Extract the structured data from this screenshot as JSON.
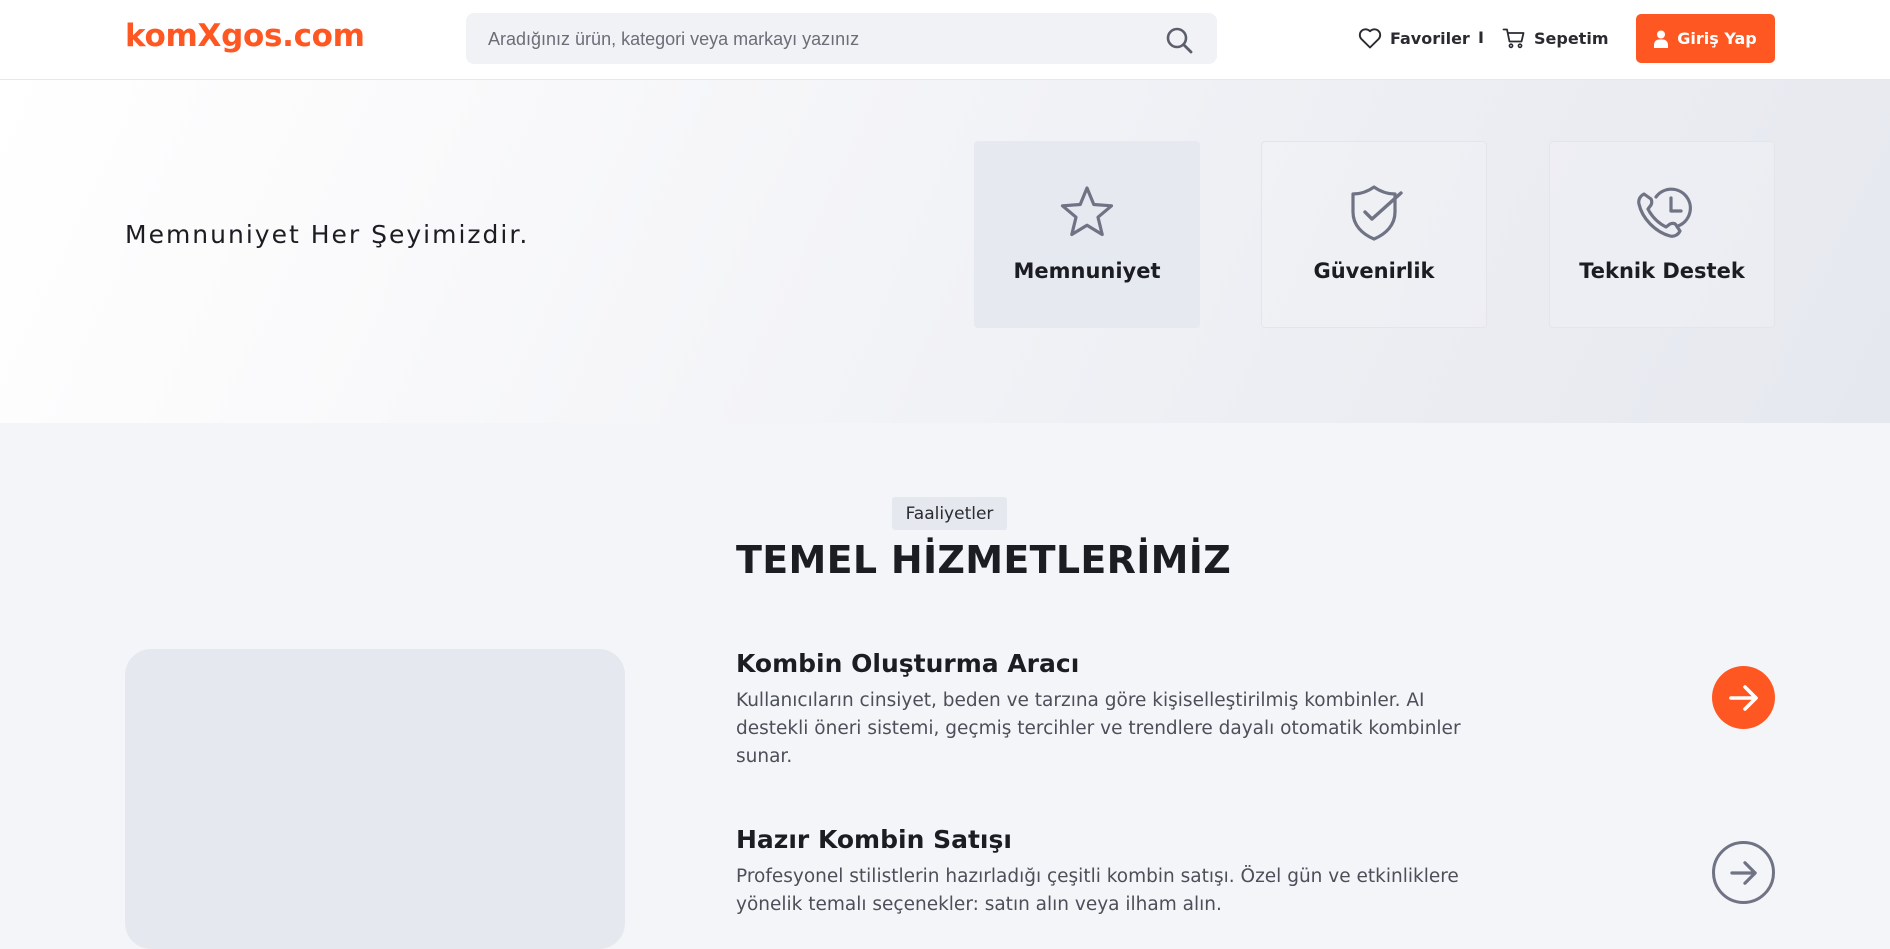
{
  "header": {
    "logo": "komXgos.com",
    "search_placeholder": "Aradığınız ürün, kategori veya markayı yazınız",
    "favorites_label": "Favoriler",
    "separator": "I",
    "cart_label": "Sepetim",
    "login_label": "Giriş Yap"
  },
  "hero": {
    "tagline": "Memnuniyet Her Şeyimizdir.",
    "features": [
      {
        "label": "Memnuniyet",
        "icon": "star-icon"
      },
      {
        "label": "Güvenirlik",
        "icon": "shield-check-icon"
      },
      {
        "label": "Teknik Destek",
        "icon": "phone-clock-icon"
      }
    ]
  },
  "services": {
    "badge": "Faaliyetler",
    "title": "TEMEL HİZMETLERİMİZ",
    "items": [
      {
        "title": "Kombin Oluşturma Aracı",
        "description": "Kullanıcıların cinsiyet, beden ve tarzına göre kişiselleştirilmiş kombinler. AI destekli öneri sistemi, geçmiş tercihler ve trendlere dayalı otomatik kombinler sunar."
      },
      {
        "title": "Hazır Kombin Satışı",
        "description": "Profesyonel stilistlerin hazırladığı çeşitli kombin satışı. Özel gün ve etkinliklere yönelik temalı seçenekler: satın alın veya ilham alın."
      }
    ]
  },
  "colors": {
    "accent": "#ff5722",
    "icon_gray": "#6f7384",
    "text_dark": "#1c1d22"
  }
}
